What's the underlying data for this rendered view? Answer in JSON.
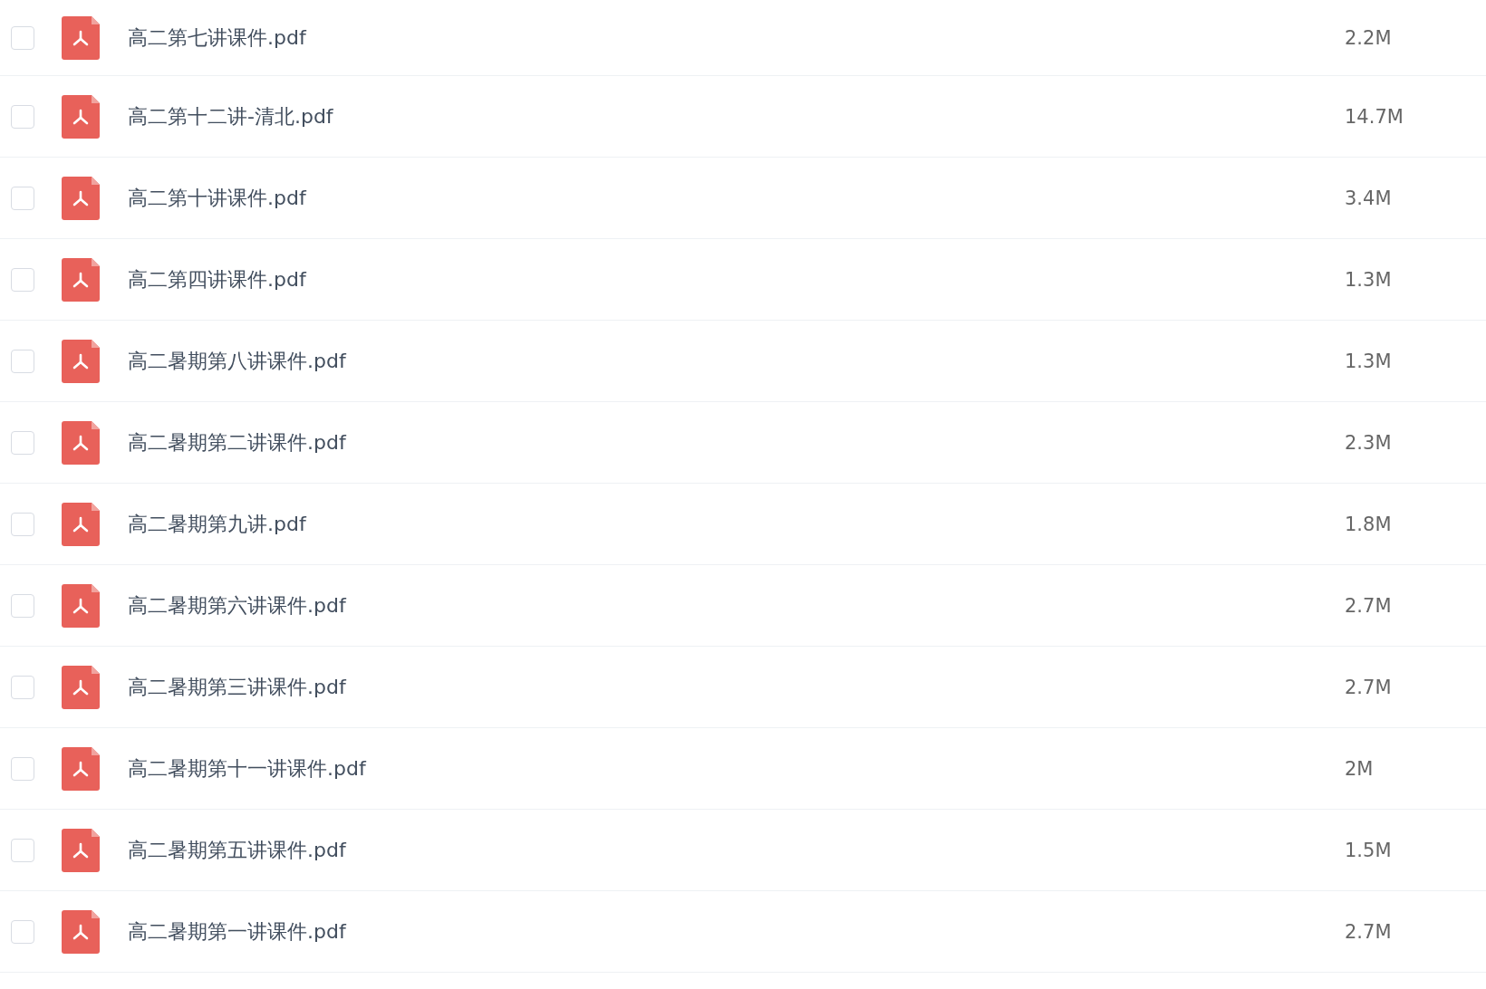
{
  "files": [
    {
      "name": "高二第七讲课件.pdf",
      "size": "2.2M",
      "checked": false
    },
    {
      "name": "高二第十二讲-清北.pdf",
      "size": "14.7M",
      "checked": false
    },
    {
      "name": "高二第十讲课件.pdf",
      "size": "3.4M",
      "checked": false
    },
    {
      "name": "高二第四讲课件.pdf",
      "size": "1.3M",
      "checked": false
    },
    {
      "name": "高二暑期第八讲课件.pdf",
      "size": "1.3M",
      "checked": false
    },
    {
      "name": "高二暑期第二讲课件.pdf",
      "size": "2.3M",
      "checked": false
    },
    {
      "name": "高二暑期第九讲.pdf",
      "size": "1.8M",
      "checked": false
    },
    {
      "name": "高二暑期第六讲课件.pdf",
      "size": "2.7M",
      "checked": false
    },
    {
      "name": "高二暑期第三讲课件.pdf",
      "size": "2.7M",
      "checked": false
    },
    {
      "name": "高二暑期第十一讲课件.pdf",
      "size": "2M",
      "checked": false
    },
    {
      "name": "高二暑期第五讲课件.pdf",
      "size": "1.5M",
      "checked": false
    },
    {
      "name": "高二暑期第一讲课件.pdf",
      "size": "2.7M",
      "checked": false
    }
  ]
}
